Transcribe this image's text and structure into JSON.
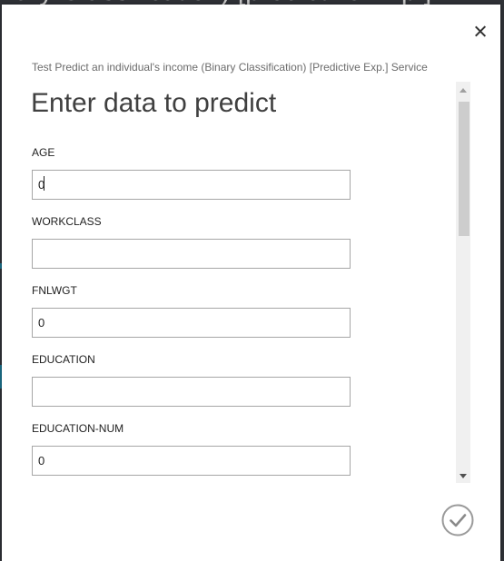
{
  "background": {
    "title_fragment": "nary Classification) [predictive Exp.]"
  },
  "dialog": {
    "subtitle": "Test Predict an individual's income (Binary Classification) [Predictive Exp.] Service",
    "title": "Enter data to predict",
    "close_icon": "close-icon",
    "submit_icon": "checkmark-icon",
    "fields": [
      {
        "label": "AGE",
        "value": "0"
      },
      {
        "label": "WORKCLASS",
        "value": ""
      },
      {
        "label": "FNLWGT",
        "value": "0"
      },
      {
        "label": "EDUCATION",
        "value": ""
      },
      {
        "label": "EDUCATION-NUM",
        "value": "0"
      }
    ]
  },
  "colors": {
    "backdrop": "#2f3136",
    "dialog_bg": "#ffffff",
    "input_border": "#a6a6a6",
    "submit_gray": "#9a9a9a"
  }
}
